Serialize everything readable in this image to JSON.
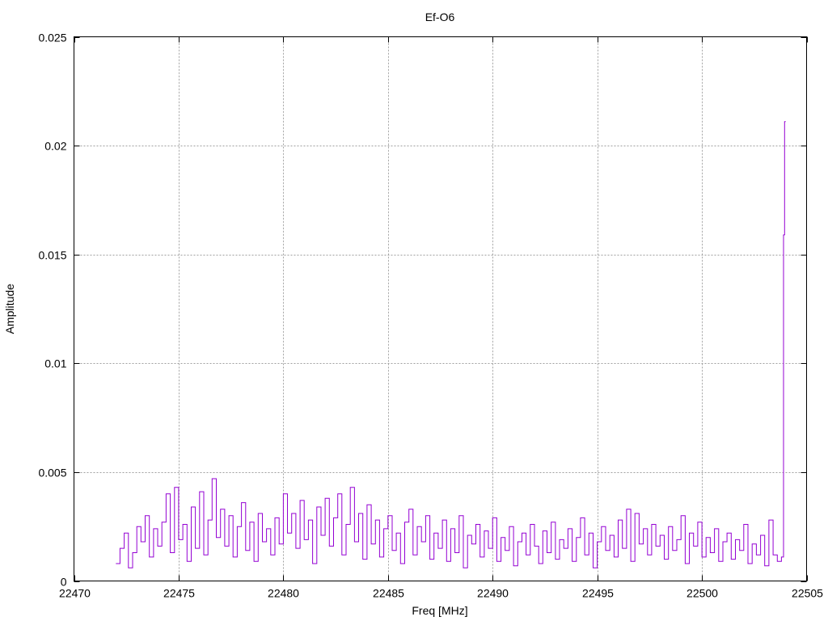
{
  "chart_data": {
    "type": "line",
    "style": "steps",
    "title": "Ef-O6",
    "xlabel": "Freq [MHz]",
    "ylabel": "Amplitude",
    "xlim": [
      22470,
      22505
    ],
    "ylim": [
      0,
      0.025
    ],
    "grid": true,
    "xticks": [
      "22470",
      "22475",
      "22480",
      "22485",
      "22490",
      "22495",
      "22500",
      "22505"
    ],
    "xtick_values": [
      22470,
      22475,
      22480,
      22485,
      22490,
      22495,
      22500,
      22505
    ],
    "yticks": [
      "0",
      "0.005",
      "0.01",
      "0.015",
      "0.02",
      "0.025"
    ],
    "ytick_values": [
      0,
      0.005,
      0.01,
      0.015,
      0.02,
      0.025
    ],
    "series": [
      {
        "name": "Ef-O6",
        "color": "#9400d3",
        "x_start": 22472.0,
        "x_step": 0.2,
        "values": [
          0.0008,
          0.0015,
          0.0022,
          0.0006,
          0.0013,
          0.0025,
          0.0018,
          0.003,
          0.0011,
          0.0024,
          0.0016,
          0.0027,
          0.004,
          0.0013,
          0.0043,
          0.0019,
          0.0026,
          0.0009,
          0.0034,
          0.0015,
          0.0041,
          0.0012,
          0.0028,
          0.0047,
          0.002,
          0.0033,
          0.0016,
          0.003,
          0.0011,
          0.0025,
          0.0036,
          0.0014,
          0.0027,
          0.0009,
          0.0031,
          0.0018,
          0.0024,
          0.0012,
          0.0029,
          0.0017,
          0.004,
          0.0022,
          0.0031,
          0.0015,
          0.0037,
          0.0019,
          0.0028,
          0.0008,
          0.0034,
          0.0021,
          0.0038,
          0.0016,
          0.0029,
          0.004,
          0.0012,
          0.0026,
          0.0043,
          0.0018,
          0.0031,
          0.001,
          0.0035,
          0.0017,
          0.0028,
          0.0011,
          0.0024,
          0.003,
          0.0014,
          0.0022,
          0.0008,
          0.0027,
          0.0033,
          0.0012,
          0.0025,
          0.0018,
          0.003,
          0.001,
          0.0022,
          0.0015,
          0.0028,
          0.0009,
          0.0024,
          0.0013,
          0.003,
          0.0006,
          0.0021,
          0.0017,
          0.0026,
          0.0011,
          0.0023,
          0.0015,
          0.0029,
          0.0009,
          0.002,
          0.0014,
          0.0025,
          0.0007,
          0.0018,
          0.0022,
          0.0012,
          0.0026,
          0.0016,
          0.0008,
          0.0023,
          0.0013,
          0.0027,
          0.001,
          0.0019,
          0.0015,
          0.0024,
          0.0009,
          0.002,
          0.0029,
          0.0012,
          0.0022,
          0.0006,
          0.0018,
          0.0025,
          0.0014,
          0.0021,
          0.0011,
          0.0028,
          0.0015,
          0.0033,
          0.0009,
          0.0031,
          0.0017,
          0.0024,
          0.0012,
          0.0026,
          0.0016,
          0.0021,
          0.001,
          0.0025,
          0.0014,
          0.0019,
          0.003,
          0.0008,
          0.0022,
          0.0016,
          0.0027,
          0.0011,
          0.002,
          0.0013,
          0.0024,
          0.0009,
          0.0018,
          0.0022,
          0.001,
          0.0019,
          0.0014,
          0.0026,
          0.0008,
          0.0017,
          0.0012,
          0.0021,
          0.0007,
          0.0028,
          0.0012,
          0.0009,
          0.0011
        ],
        "extra_points": [
          [
            22503.9,
            0.0159
          ],
          [
            22503.95,
            0.0211
          ],
          [
            22504.0,
            0.0211
          ]
        ]
      }
    ]
  }
}
